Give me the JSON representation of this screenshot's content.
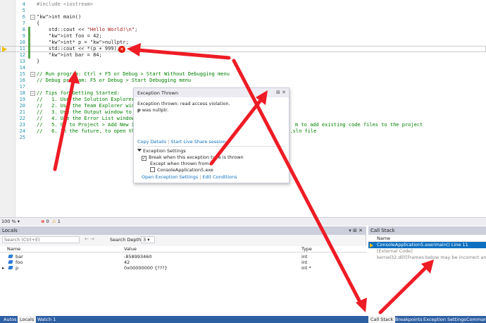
{
  "editor": {
    "lines": [
      {
        "n": "4",
        "code": "#include <iostream>",
        "kind": "pre"
      },
      {
        "n": "5",
        "code": "",
        "kind": "plain"
      },
      {
        "n": "6",
        "code": "int main()",
        "kind": "plain"
      },
      {
        "n": "7",
        "code": "{",
        "kind": "plain"
      },
      {
        "n": "8",
        "code": "    std::cout << \"Hello World!\\n\";",
        "kind": "plain"
      },
      {
        "n": "9",
        "code": "    int foo = 42;",
        "kind": "plain"
      },
      {
        "n": "10",
        "code": "    int* p = nullptr;",
        "kind": "plain"
      },
      {
        "n": "11",
        "code": "    std::cout << *(p + 999);",
        "kind": "plain"
      },
      {
        "n": "12",
        "code": "    int bar = 84;",
        "kind": "plain"
      },
      {
        "n": "13",
        "code": "}",
        "kind": "plain"
      },
      {
        "n": "14",
        "code": "",
        "kind": "plain"
      },
      {
        "n": "15",
        "code": "// Run program: Ctrl + F5 or Debug > Start Without Debugging menu",
        "kind": "comment"
      },
      {
        "n": "16",
        "code": "// Debug program: F5 or Debug > Start Debugging menu",
        "kind": "comment"
      },
      {
        "n": "17",
        "code": "",
        "kind": "plain"
      },
      {
        "n": "18",
        "code": "// Tips for Getting Started:",
        "kind": "comment"
      },
      {
        "n": "19",
        "code": "//   1. Use the Solution Explorer w",
        "kind": "comment"
      },
      {
        "n": "20",
        "code": "//   2. Use the Team Explorer windo",
        "kind": "comment"
      },
      {
        "n": "21",
        "code": "//   3. Use the Output window to se",
        "kind": "comment"
      },
      {
        "n": "22",
        "code": "//   4. Use the Error List window t",
        "kind": "comment"
      },
      {
        "n": "23",
        "code": "//   5. Go to Project > Add New Ite",
        "kind": "comment"
      },
      {
        "n": "24",
        "code": "//   6. In the future, to open this",
        "kind": "comment"
      },
      {
        "n": "25",
        "code": "",
        "kind": "plain"
      }
    ],
    "tail_23": "m to add existing code files to the project",
    "tail_24": "e .sln file"
  },
  "exception": {
    "title": "Exception Thrown",
    "message_line1": "Exception thrown: read access violation.",
    "message_var": "p",
    "message_line2": " was nullptr.",
    "link_copy": "Copy Details",
    "link_sep": " | ",
    "link_liveshare": "Start Live Share session...",
    "settings_header": "Exception Settings",
    "break_label": "Break when this exception type is thrown",
    "except_label": "Except when thrown from:",
    "module_label": "ConsoleApplication5.exe",
    "open_settings": "Open Exception Settings",
    "edit_conditions": "Edit Conditions"
  },
  "status": {
    "zoom": "100 %",
    "errors": "0",
    "warnings": "1"
  },
  "locals": {
    "title": "Locals",
    "search_placeholder": "Search (Ctrl+E)",
    "search_depth_label": "Search Depth:",
    "search_depth_value": "3",
    "columns": {
      "name": "Name",
      "value": "Value",
      "type": "Type"
    },
    "rows": [
      {
        "name": "bar",
        "value": "-858993460",
        "type": "int"
      },
      {
        "name": "foo",
        "value": "42",
        "type": "int"
      },
      {
        "name": "p",
        "value": "0x00000000 {???}",
        "type": "int *"
      }
    ]
  },
  "callstack": {
    "title": "Call Stack",
    "column_name": "Name",
    "rows": [
      {
        "text": "ConsoleApplication5.exe!main() Line 11",
        "state": "sel"
      },
      {
        "text": "[External Code]",
        "state": "dim"
      },
      {
        "text": "kernel32.dll![Frames below may be incorrect and/or m",
        "state": "dim"
      }
    ]
  },
  "tabs": {
    "autos": "Autos",
    "locals": "Locals",
    "watch1": "Watch 1",
    "callstack": "Call Stack",
    "breakpoints": "Breakpoints",
    "exception_settings": "Exception Settings",
    "command": "Command"
  },
  "colors": {
    "annotation_arrow": "#ee1c25",
    "tab_bar": "#2d5fa3",
    "selection": "#0e70c0"
  }
}
